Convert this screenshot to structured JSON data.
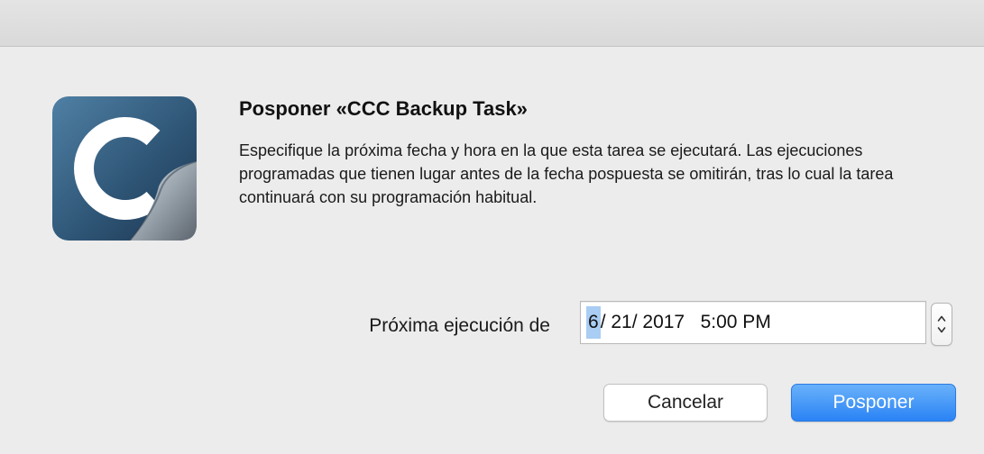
{
  "dialog": {
    "title": "Posponer «CCC Backup Task»",
    "message": "Especifique la próxima fecha y hora en la que esta tarea se ejecutará. Las ejecuciones programadas que tienen lugar antes de la fecha pospuesta se omitirán, tras lo cual la tarea continuará con su programación habitual.",
    "app_icon": "carbon-copy-cloner-icon"
  },
  "next_run": {
    "label": "Próxima ejecución de",
    "month": "6",
    "rest": "/ 21/ 2017   5:00 PM",
    "stepper_icon": "up-down-stepper-icon"
  },
  "buttons": {
    "cancel": "Cancelar",
    "postpone": "Posponer"
  },
  "colors": {
    "accent": "#2a83f5",
    "selection": "#a9cdf3"
  }
}
